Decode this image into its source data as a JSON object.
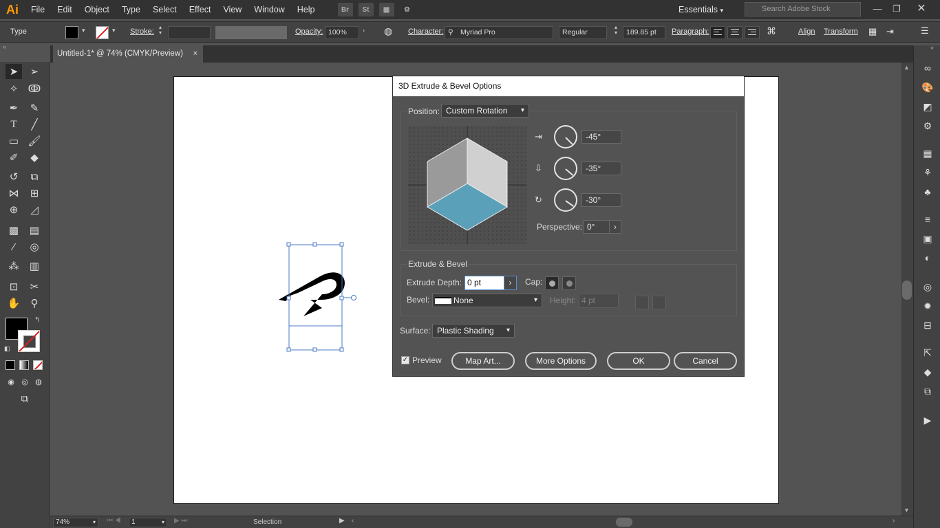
{
  "app": {
    "logo": "Ai"
  },
  "menu": [
    "File",
    "Edit",
    "Object",
    "Type",
    "Select",
    "Effect",
    "View",
    "Window",
    "Help"
  ],
  "menubar_icons": {
    "bridge": "Br",
    "stock": "St"
  },
  "workspace": "Essentials",
  "search_stock": {
    "placeholder": "Search Adobe Stock"
  },
  "control_bar": {
    "selection_type": "Type",
    "stroke_label": "Stroke:",
    "opacity_label": "Opacity:",
    "opacity_value": "100%",
    "character_label": "Character:",
    "font_family": "Myriad Pro",
    "font_style": "Regular",
    "font_size": "189.85 pt",
    "paragraph_label": "Paragraph:",
    "align_label": "Align",
    "transform_label": "Transform"
  },
  "document_tab": {
    "title": "Untitled-1* @ 74% (CMYK/Preview)",
    "close": "×"
  },
  "status_bar": {
    "zoom": "74%",
    "page": "1",
    "tool": "Selection"
  },
  "dialog": {
    "title": "3D Extrude & Bevel Options",
    "position_label": "Position:",
    "position_value": "Custom Rotation",
    "rotation_x": "-45°",
    "rotation_y": "-35°",
    "rotation_z": "-30°",
    "perspective_label": "Perspective:",
    "perspective_value": "0°",
    "extrude_section": "Extrude & Bevel",
    "extrude_depth_label": "Extrude Depth:",
    "extrude_depth_value": "0 pt",
    "cap_label": "Cap:",
    "bevel_label": "Bevel:",
    "bevel_value": "None",
    "height_label": "Height:",
    "height_value": "4 pt",
    "surface_label": "Surface:",
    "surface_value": "Plastic Shading",
    "preview_label": "Preview",
    "preview_checked": true,
    "buttons": {
      "map_art": "Map Art...",
      "more_options": "More Options",
      "ok": "OK",
      "cancel": "Cancel"
    }
  },
  "colors": {
    "logo": "#ff9a00",
    "cube_front": "#5aa0b8",
    "cube_left": "#9a9a9a",
    "cube_right": "#d0d0d0",
    "selection": "#4a78c8"
  }
}
